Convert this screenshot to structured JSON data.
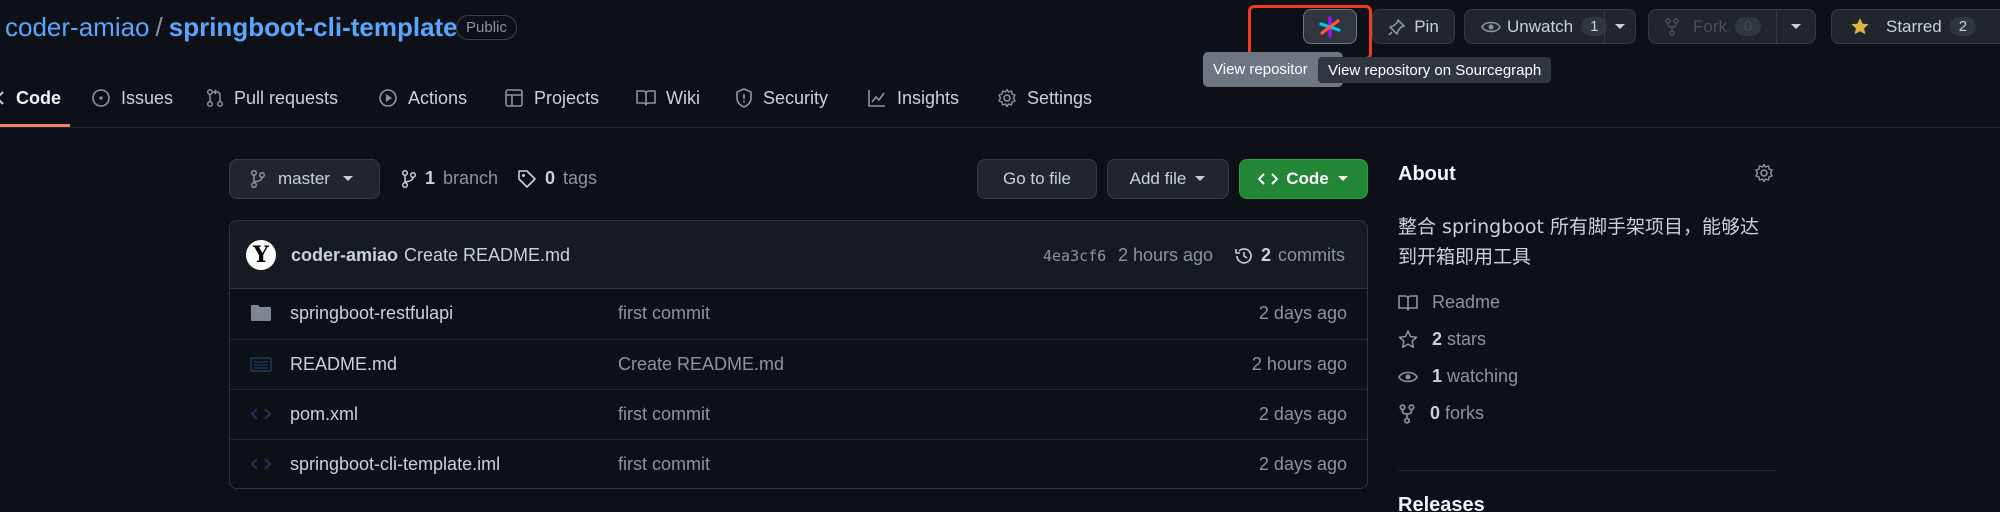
{
  "repo": {
    "owner": "coder-amiao",
    "separator": "/",
    "name": "springboot-cli-template",
    "visibility": "Public"
  },
  "actions": {
    "sourcegraph_tooltip_partial": "View repositor",
    "sourcegraph_tooltip": "View repository on Sourcegraph",
    "pin_label": "Pin",
    "unwatch_label": "Unwatch",
    "watch_count": "1",
    "fork_label": "Fork",
    "fork_count": "0",
    "starred_label": "Starred",
    "star_count": "2"
  },
  "nav": {
    "tabs": [
      {
        "label": "Code",
        "icon": "code-icon",
        "selected": true
      },
      {
        "label": "Issues",
        "icon": "issue-icon"
      },
      {
        "label": "Pull requests",
        "icon": "pull-request-icon"
      },
      {
        "label": "Actions",
        "icon": "play-icon"
      },
      {
        "label": "Projects",
        "icon": "table-icon"
      },
      {
        "label": "Wiki",
        "icon": "book-icon"
      },
      {
        "label": "Security",
        "icon": "shield-icon"
      },
      {
        "label": "Insights",
        "icon": "graph-icon"
      },
      {
        "label": "Settings",
        "icon": "gear-icon"
      }
    ]
  },
  "toolbar": {
    "branch": "master",
    "branch_count": "1",
    "branch_word": "branch",
    "tag_count": "0",
    "tag_word": "tags",
    "go_to_file": "Go to file",
    "add_file": "Add file",
    "code": "Code"
  },
  "commit": {
    "author": "coder-amiao",
    "message": "Create README.md",
    "sha": "4ea3cf6",
    "time": "2 hours ago",
    "commit_count": "2",
    "commit_word": "commits"
  },
  "files": [
    {
      "name": "springboot-restfulapi",
      "type": "folder",
      "message": "first commit",
      "age": "2 days ago"
    },
    {
      "name": "README.md",
      "type": "file",
      "message": "Create README.md",
      "age": "2 hours ago"
    },
    {
      "name": "pom.xml",
      "type": "code-file",
      "message": "first commit",
      "age": "2 days ago"
    },
    {
      "name": "springboot-cli-template.iml",
      "type": "code-file",
      "message": "first commit",
      "age": "2 days ago"
    }
  ],
  "about": {
    "title": "About",
    "description_line1": "整合 springboot 所有脚手架项目，能够达",
    "description_line2": "到开箱即用工具",
    "readme": "Readme",
    "stars_count": "2",
    "stars_word": "stars",
    "watching_count": "1",
    "watching_word": "watching",
    "forks_count": "0",
    "forks_word": "forks"
  },
  "releases": {
    "title": "Releases"
  },
  "colors": {
    "background": "#0d1117",
    "link": "#58a6ff",
    "selected_tab_underline": "#f78166",
    "code_button": "#238636",
    "highlight_box": "#f0391f",
    "star_icon": "#e3b341"
  }
}
